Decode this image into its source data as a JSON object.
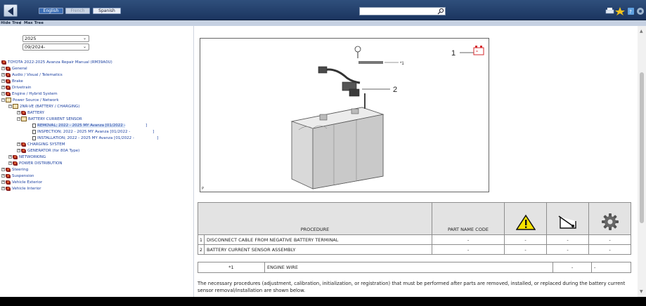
{
  "topbar": {
    "languages": [
      "English",
      "French",
      "Spanish"
    ],
    "search_placeholder": ""
  },
  "subbar": {
    "hide_tree": "Hide Tree",
    "separator": "/",
    "max_tree": "Max Tree"
  },
  "filters": {
    "year": "2025",
    "date": "09/2024-"
  },
  "tree": {
    "root": "TOYOTA 2022-2025 Avanza Repair Manual (RM39A0U)",
    "items": [
      "General",
      "Audio / Visual / Telematics",
      "Brake",
      "Drivetrain",
      "Engine / Hybrid System",
      "Power Source / Network",
      "2NR-VE (BATTERY / CHARGING)",
      "BATTERY",
      "BATTERY CURRENT SENSOR",
      "REMOVAL; 2022 - 2025 MY Avanza [01/2022 -",
      "INSPECTION; 2022 - 2025 MY Avanza [01/2022 -",
      "INSTALLATION; 2022 - 2025 MY Avanza [01/2022 -",
      "CHARGING SYSTEM",
      "GENERATOR (for 80A Type)",
      "NETWORKING",
      "POWER DISTRIBUTION",
      "Steering",
      "Suspension",
      "Vehicle Exterior",
      "Vehicle Interior"
    ],
    "bracket": "]"
  },
  "figure": {
    "callout_1": "1",
    "callout_2": "2",
    "callout_star1": "*1",
    "corner_label": "P"
  },
  "procedure_table": {
    "headers": {
      "procedure": "PROCEDURE",
      "part_name_code": "PART NAME CODE"
    },
    "icons": [
      "warning-icon",
      "lever-gauge-icon",
      "gear-icon"
    ],
    "rows": [
      {
        "num": "1",
        "procedure": "DISCONNECT CABLE FROM NEGATIVE BATTERY TERMINAL",
        "code": "-",
        "c1": "-",
        "c2": "-",
        "c3": "-"
      },
      {
        "num": "2",
        "procedure": "BATTERY CURRENT SENSOR ASSEMBLY",
        "code": "-",
        "c1": "-",
        "c2": "-",
        "c3": "-"
      }
    ]
  },
  "reference_table": {
    "label": "*1",
    "text": "ENGINE WIRE",
    "c1": "-",
    "c2": "-"
  },
  "note": "The necessary procedures (adjustment, calibration, initialization, or registration) that must be performed after parts are removed, installed, or replaced during the battery current sensor removal/installation are shown below.",
  "colors": {
    "topbar": "#1b3560",
    "accent_red": "#d6282c",
    "warning_yellow": "#f7e300"
  }
}
